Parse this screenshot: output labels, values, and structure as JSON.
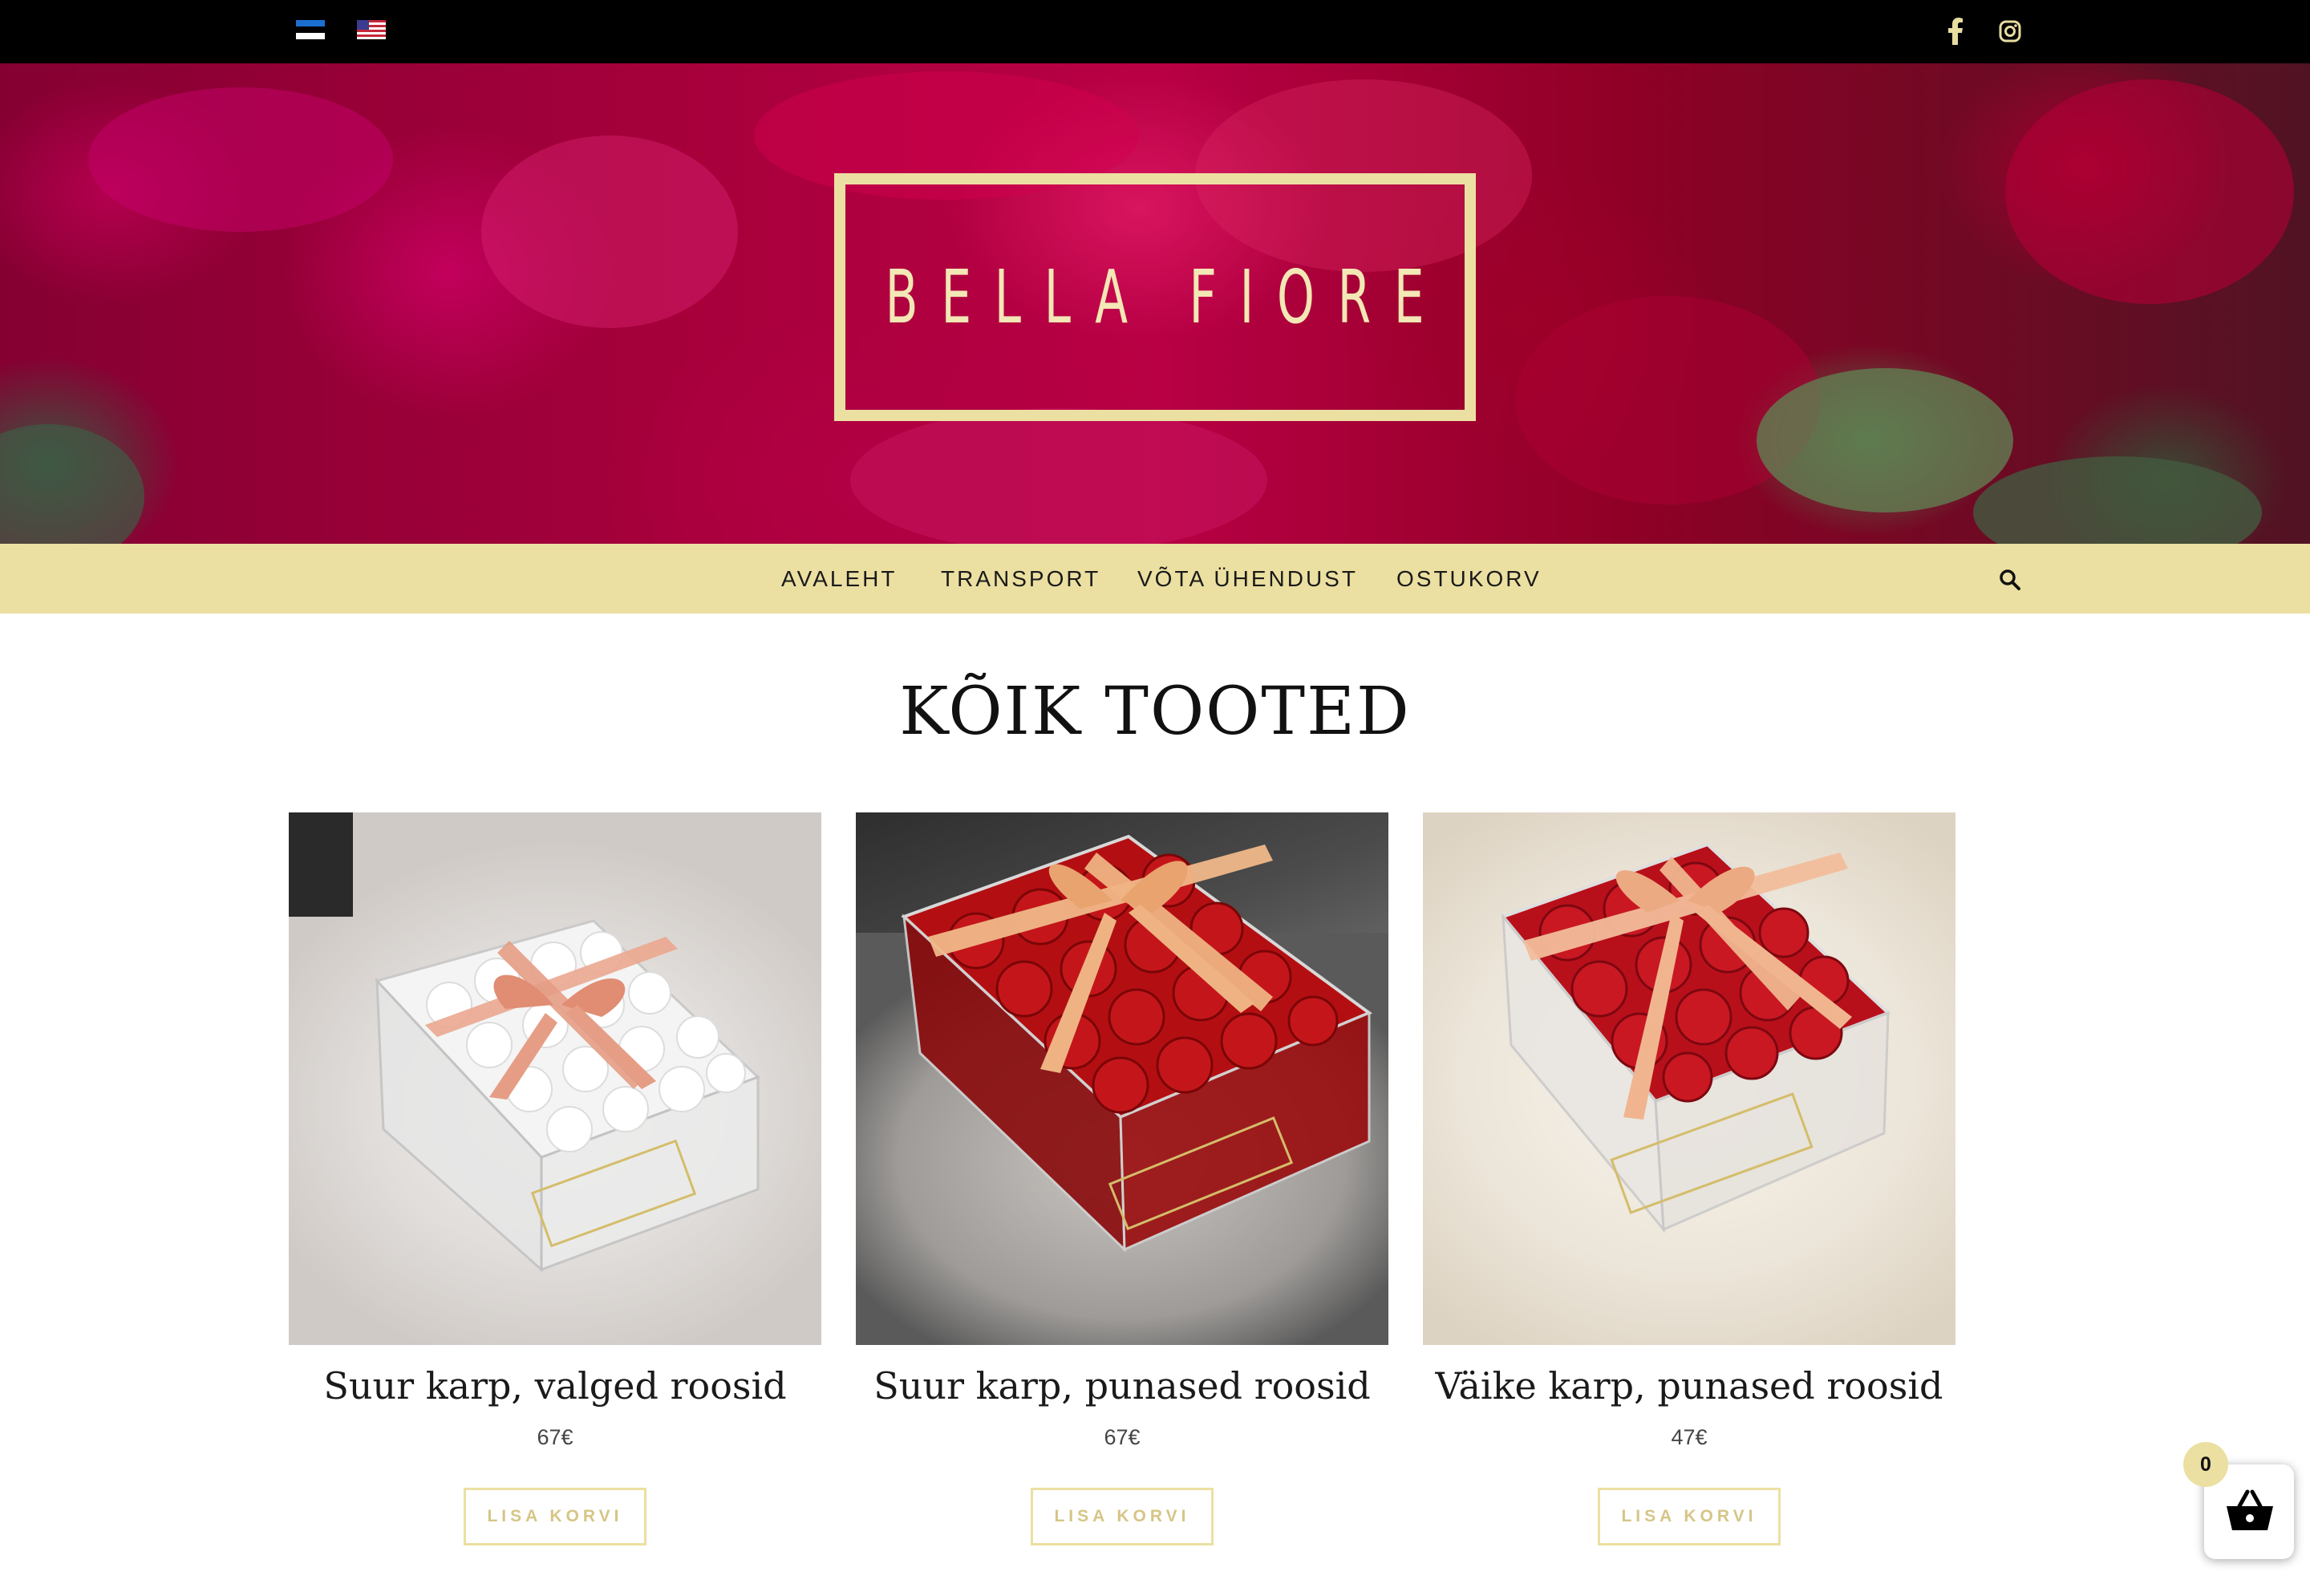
{
  "topbar": {
    "languages": [
      {
        "code": "et",
        "icon": "estonia-flag-icon"
      },
      {
        "code": "en",
        "icon": "usa-flag-icon"
      }
    ],
    "social": [
      {
        "name": "facebook",
        "icon": "facebook-icon"
      },
      {
        "name": "instagram",
        "icon": "instagram-icon"
      }
    ]
  },
  "hero": {
    "logo_text": "BELLA FIORE",
    "logo_color": "#ecdfa2"
  },
  "nav": {
    "items": [
      {
        "label": "AVALEHT"
      },
      {
        "label": "TRANSPORT"
      },
      {
        "label": "VÕTA ÜHENDUST"
      },
      {
        "label": "OSTUKORV"
      }
    ],
    "search_icon": "search-icon",
    "background": "#ebe0a1"
  },
  "page": {
    "title": "KÕIK TOOTED"
  },
  "products": [
    {
      "name": "Suur karp, valged roosid",
      "price": "67€",
      "button": "LISA KORVI"
    },
    {
      "name": "Suur karp, punased roosid",
      "price": "67€",
      "button": "LISA KORVI"
    },
    {
      "name": "Väike karp, punased roosid",
      "price": "47€",
      "button": "LISA KORVI"
    }
  ],
  "cart": {
    "count": "0",
    "icon": "basket-icon"
  },
  "colors": {
    "accent": "#ebe0a1",
    "topbar": "#000000",
    "button_text": "#d6c586"
  }
}
